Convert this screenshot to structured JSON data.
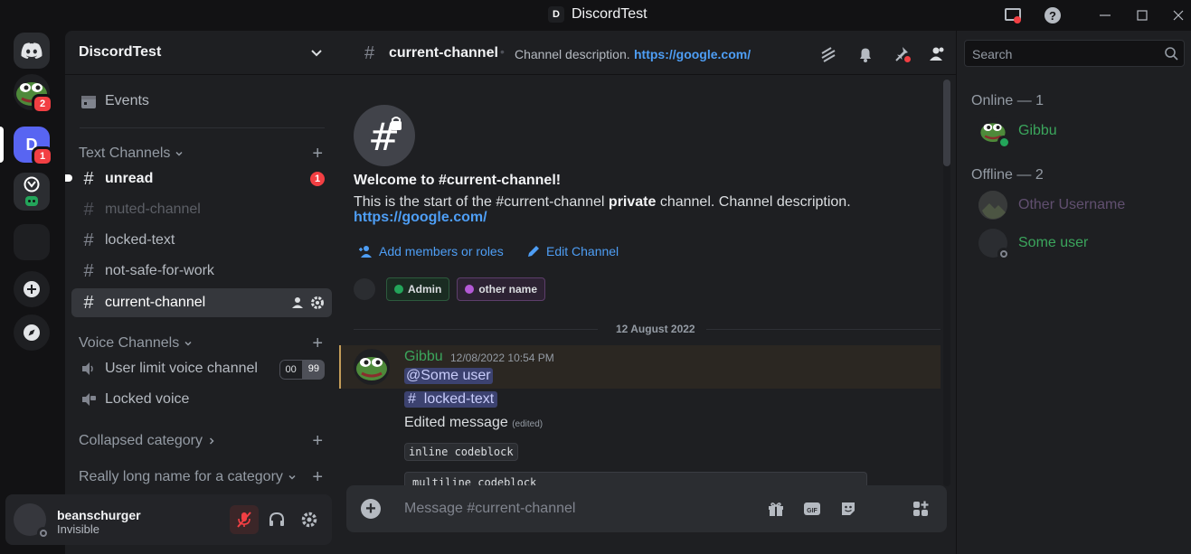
{
  "window": {
    "title": "DiscordTest",
    "title_badge": "D"
  },
  "rail": {
    "home_icon": "discord-icon",
    "servers": [
      {
        "name": "pepe-server",
        "badge": "2"
      },
      {
        "name": "D",
        "badge": "1"
      },
      {
        "name": "overwatch-folder"
      },
      {
        "name": "empty-server"
      }
    ]
  },
  "guild": {
    "name": "DiscordTest",
    "events_label": "Events",
    "categories": {
      "text": "Text Channels",
      "voice": "Voice Channels",
      "collapsed": "Collapsed category",
      "long": "Really long name for a category"
    },
    "channels": [
      {
        "name": "unread",
        "badge": "1"
      },
      {
        "name": "muted-channel"
      },
      {
        "name": "locked-text"
      },
      {
        "name": "not-safe-for-work"
      },
      {
        "name": "current-channel"
      }
    ],
    "voice_channels": [
      {
        "name": "User limit voice channel",
        "current": "00",
        "limit": "99"
      },
      {
        "name": "Locked voice"
      }
    ]
  },
  "user": {
    "name": "beanschurger",
    "status": "Invisible"
  },
  "channel_header": {
    "name": "current-channel",
    "description": "Channel description.",
    "link": "https://google.com/"
  },
  "welcome": {
    "title": "Welcome to #current-channel!",
    "text_start": "This is the start of the #current-channel ",
    "text_bold": "private",
    "text_end": " channel. Channel description.",
    "link": "https://google.com/",
    "add_members": "Add members or roles",
    "edit_channel": "Edit Channel",
    "roles": [
      {
        "name": "Admin",
        "color": "#23a55a"
      },
      {
        "name": "other name",
        "color": "#b459d6"
      }
    ]
  },
  "date_divider": "12 August 2022",
  "message": {
    "author": "Gibbu",
    "timestamp": "12/08/2022 10:54 PM",
    "mention": "@Some user",
    "channel_mention_hash": "#",
    "channel_mention": "locked-text",
    "edited_text": "Edited message",
    "edited_tag": "(edited)",
    "inline_code": "inline codeblock",
    "code_block": "multiline codeblock"
  },
  "composer": {
    "placeholder": "Message #current-channel"
  },
  "search": {
    "placeholder": "Search"
  },
  "members": {
    "online_header": "Online — 1",
    "offline_header": "Offline — 2",
    "online": [
      {
        "name": "Gibbu",
        "color": "#3ba55c"
      }
    ],
    "offline": [
      {
        "name": "Other Username",
        "color": "#5b4a66"
      },
      {
        "name": "Some user",
        "color": "#3ba55c"
      }
    ]
  },
  "colors": {
    "accent": "#5865f2",
    "link": "#4e9ef5",
    "danger": "#f23f43",
    "online": "#23a55a"
  }
}
